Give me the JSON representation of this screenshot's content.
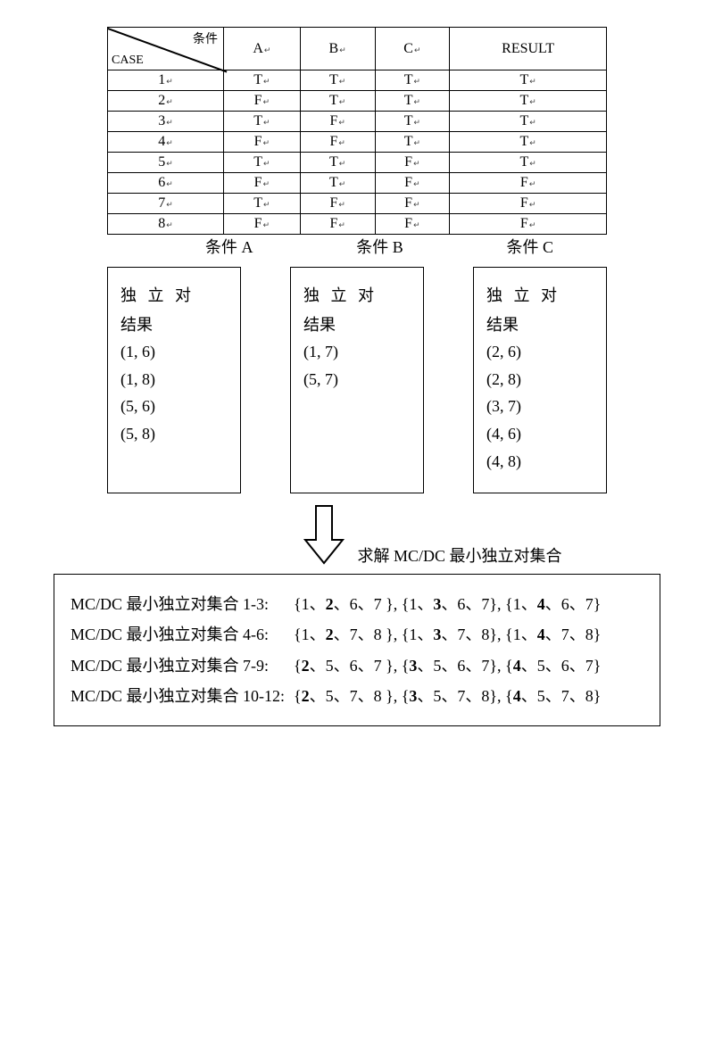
{
  "tableHeader": {
    "cornerTop": "条件",
    "cornerBottom": "CASE",
    "cols": [
      "A",
      "B",
      "C",
      "RESULT"
    ]
  },
  "rows": [
    {
      "n": "1",
      "a": "T",
      "b": "T",
      "c": "T",
      "r": "T"
    },
    {
      "n": "2",
      "a": "F",
      "b": "T",
      "c": "T",
      "r": "T"
    },
    {
      "n": "3",
      "a": "T",
      "b": "F",
      "c": "T",
      "r": "T"
    },
    {
      "n": "4",
      "a": "F",
      "b": "F",
      "c": "T",
      "r": "T"
    },
    {
      "n": "5",
      "a": "T",
      "b": "T",
      "c": "F",
      "r": "T"
    },
    {
      "n": "6",
      "a": "F",
      "b": "T",
      "c": "F",
      "r": "F"
    },
    {
      "n": "7",
      "a": "T",
      "b": "F",
      "c": "F",
      "r": "F"
    },
    {
      "n": "8",
      "a": "F",
      "b": "F",
      "c": "F",
      "r": "F"
    }
  ],
  "condLabels": {
    "a": "条件 A",
    "b": "条件 B",
    "c": "条件 C"
  },
  "pairHeader1": "独 立 对",
  "pairHeader2": "结果",
  "pairsA": [
    "(1, 6)",
    "(1, 8)",
    "(5, 6)",
    "(5, 8)"
  ],
  "pairsB": [
    "(1, 7)",
    "(5, 7)"
  ],
  "pairsC": [
    "(2, 6)",
    "(2, 8)",
    "(3, 7)",
    "(4, 6)",
    "(4, 8)"
  ],
  "arrowLabel": "求解 MC/DC 最小独立对集合",
  "results": {
    "label1": "MC/DC 最小独立对集合 1-3:",
    "label2": "MC/DC 最小独立对集合 4-6:",
    "label3": "MC/DC 最小独立对集合 7-9:",
    "label4": "MC/DC 最小独立对集合 10-12:",
    "line1a": "{1、",
    "line1b": "2",
    "line1c": "、6、7 }, {1、",
    "line1d": "3",
    "line1e": "、6、7}, {1、",
    "line1f": "4",
    "line1g": "、6、7}",
    "line2a": "{1、",
    "line2b": "2",
    "line2c": "、7、8 }, {1、",
    "line2d": "3",
    "line2e": "、7、8}, {1、",
    "line2f": "4",
    "line2g": "、7、8}",
    "line3a": "{",
    "line3b": "2",
    "line3c": "、5、6、7 }, {",
    "line3d": "3",
    "line3e": "、5、6、7}, {",
    "line3f": "4",
    "line3g": "、5、6、7}",
    "line4a": "{",
    "line4b": "2",
    "line4c": "、5、7、8 }, {",
    "line4d": "3",
    "line4e": "、5、7、8}, {",
    "line4f": "4",
    "line4g": "、5、7、8}"
  },
  "sup": "↵"
}
